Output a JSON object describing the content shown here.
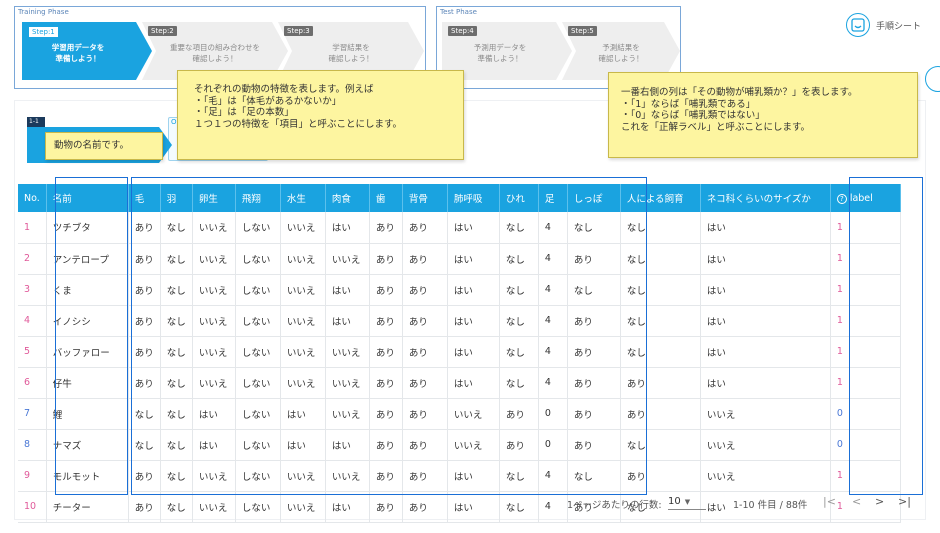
{
  "phases": {
    "training_label": "Training Phase",
    "test_label": "Test Phase"
  },
  "steps": [
    {
      "tag": "Step:1",
      "text": "学習用データを\n準備しよう！"
    },
    {
      "tag": "Step:2",
      "text": "重要な項目の組み合わせを\n確認しよう！"
    },
    {
      "tag": "Step:3",
      "text": "学習結果を\n確認しよう！"
    },
    {
      "tag": "Step:4",
      "text": "予測用データを\n準備しよう！"
    },
    {
      "tag": "Step:5",
      "text": "予測結果を\n確認しよう！"
    }
  ],
  "help": {
    "label": "手順シート"
  },
  "section_badge": "1-1",
  "tab_second_tag": "O",
  "callouts": {
    "name": "動物の名前です。",
    "features": "それぞれの動物の特徴を表します。例えば\n・「毛」は「体毛があるかないか」\n・「足」は「足の本数」\n１つ１つの特徴を「項目」と呼ぶことにします。",
    "label": "一番右側の列は「その動物が哺乳類か？」を表します。\n・「1」ならば「哺乳類である」\n・「0」ならば「哺乳類ではない」\nこれを「正解ラベル」と呼ぶことにします。"
  },
  "table": {
    "headers": [
      "No.",
      "名前",
      "毛",
      "羽",
      "卵生",
      "飛翔",
      "水生",
      "肉食",
      "歯",
      "背骨",
      "肺呼吸",
      "ひれ",
      "足",
      "しっぽ",
      "人による飼育",
      "ネコ科くらいのサイズか",
      "label"
    ],
    "rows": [
      [
        "1",
        "ツチブタ",
        "あり",
        "なし",
        "いいえ",
        "しない",
        "いいえ",
        "はい",
        "あり",
        "あり",
        "はい",
        "なし",
        "4",
        "なし",
        "なし",
        "はい",
        "1"
      ],
      [
        "2",
        "アンテロープ",
        "あり",
        "なし",
        "いいえ",
        "しない",
        "いいえ",
        "いいえ",
        "あり",
        "あり",
        "はい",
        "なし",
        "4",
        "あり",
        "なし",
        "はい",
        "1"
      ],
      [
        "3",
        "くま",
        "あり",
        "なし",
        "いいえ",
        "しない",
        "いいえ",
        "はい",
        "あり",
        "あり",
        "はい",
        "なし",
        "4",
        "なし",
        "なし",
        "はい",
        "1"
      ],
      [
        "4",
        "イノシシ",
        "あり",
        "なし",
        "いいえ",
        "しない",
        "いいえ",
        "はい",
        "あり",
        "あり",
        "はい",
        "なし",
        "4",
        "あり",
        "なし",
        "はい",
        "1"
      ],
      [
        "5",
        "バッファロー",
        "あり",
        "なし",
        "いいえ",
        "しない",
        "いいえ",
        "いいえ",
        "あり",
        "あり",
        "はい",
        "なし",
        "4",
        "あり",
        "なし",
        "はい",
        "1"
      ],
      [
        "6",
        "仔牛",
        "あり",
        "なし",
        "いいえ",
        "しない",
        "いいえ",
        "いいえ",
        "あり",
        "あり",
        "はい",
        "なし",
        "4",
        "あり",
        "あり",
        "はい",
        "1"
      ],
      [
        "7",
        "鯉",
        "なし",
        "なし",
        "はい",
        "しない",
        "はい",
        "いいえ",
        "あり",
        "あり",
        "いいえ",
        "あり",
        "0",
        "あり",
        "あり",
        "いいえ",
        "0"
      ],
      [
        "8",
        "ナマズ",
        "なし",
        "なし",
        "はい",
        "しない",
        "はい",
        "はい",
        "あり",
        "あり",
        "いいえ",
        "あり",
        "0",
        "あり",
        "なし",
        "いいえ",
        "0"
      ],
      [
        "9",
        "モルモット",
        "あり",
        "なし",
        "いいえ",
        "しない",
        "いいえ",
        "いいえ",
        "あり",
        "あり",
        "はい",
        "なし",
        "4",
        "なし",
        "あり",
        "いいえ",
        "1"
      ],
      [
        "10",
        "チーター",
        "あり",
        "なし",
        "いいえ",
        "しない",
        "いいえ",
        "はい",
        "あり",
        "あり",
        "はい",
        "なし",
        "4",
        "あり",
        "なし",
        "はい",
        "1"
      ]
    ]
  },
  "pagination": {
    "rows_per_page_label": "1ページあたりの行数:",
    "rows_per_page_value": "10",
    "range_text": "1-10 件目 / 88件",
    "first": "|<",
    "prev": "<",
    "next": ">",
    "last": ">|"
  },
  "colors": {
    "accent": "#1aa3e0",
    "highlight": "#1a6fd6",
    "callout": "#fdf5a0"
  }
}
